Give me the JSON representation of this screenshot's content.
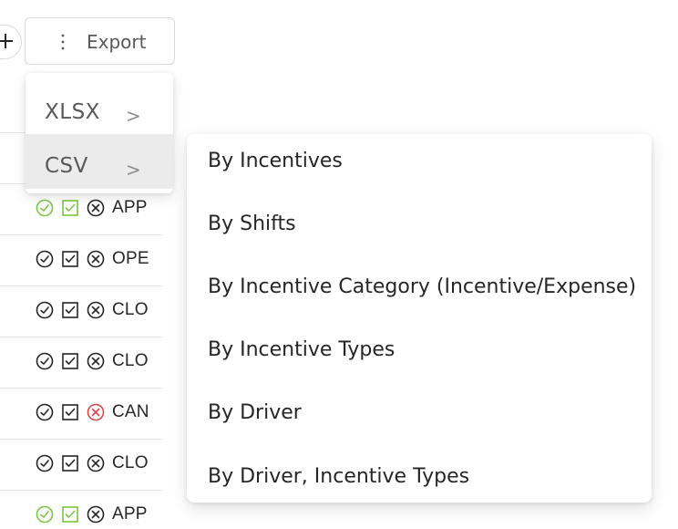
{
  "toolbar": {
    "add_icon": "plus-icon",
    "export_icon": "vertical-dots-icon",
    "export_label": "Export"
  },
  "export_menu": {
    "items": [
      {
        "label": "XLSX",
        "chevron": ">"
      },
      {
        "label": "CSV",
        "chevron": ">"
      }
    ],
    "active_item": "CSV"
  },
  "csv_submenu": {
    "items": [
      {
        "label": "By Incentives"
      },
      {
        "label": "By Shifts"
      },
      {
        "label": "By Incentive Category (Incentive/Expense)"
      },
      {
        "label": "By Incentive Types"
      },
      {
        "label": "By Driver"
      },
      {
        "label": "By Driver, Incentive Types"
      }
    ]
  },
  "table": {
    "rows": [
      {
        "status": "APP",
        "approve_color": "#7cc444",
        "check_color": "#7cc444",
        "cancel_color": "#262626"
      },
      {
        "status": "OPE",
        "approve_color": "#262626",
        "check_color": "#262626",
        "cancel_color": "#262626"
      },
      {
        "status": "CLO",
        "approve_color": "#262626",
        "check_color": "#262626",
        "cancel_color": "#262626"
      },
      {
        "status": "CLO",
        "approve_color": "#262626",
        "check_color": "#262626",
        "cancel_color": "#262626"
      },
      {
        "status": "CAN",
        "approve_color": "#262626",
        "check_color": "#262626",
        "cancel_color": "#e0434a"
      },
      {
        "status": "CLO",
        "approve_color": "#262626",
        "check_color": "#262626",
        "cancel_color": "#262626"
      },
      {
        "status": "APP",
        "approve_color": "#7cc444",
        "check_color": "#7cc444",
        "cancel_color": "#262626"
      }
    ]
  }
}
